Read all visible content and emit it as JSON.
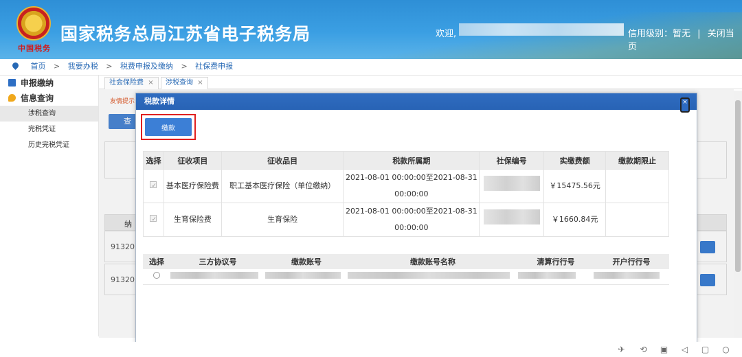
{
  "header": {
    "site_title": "国家税务总局江苏省电子税务局",
    "emblem_text": "中国税务",
    "welcome": "欢迎,",
    "credit": "信用级别：暂无",
    "divider": "|",
    "close_page": "关闭当页"
  },
  "breadcrumb": [
    "首页",
    "我要办税",
    "税费申报及缴纳",
    "社保费申报"
  ],
  "breadcrumb_sep": ">",
  "sidebar": {
    "groups": [
      {
        "label": "申报缴纳",
        "icon": "report-icon"
      },
      {
        "label": "信息查询",
        "icon": "chat-icon"
      }
    ],
    "items": [
      "涉税查询",
      "完税凭证",
      "历史完税凭证"
    ]
  },
  "tabs": [
    {
      "label": "社会保险费",
      "close": "×"
    },
    {
      "label": "涉税查询",
      "close": "×"
    }
  ],
  "background": {
    "notice": "友情提示",
    "query_btn": "查",
    "col_label": "纳",
    "row_ids": [
      "913207",
      "913207"
    ]
  },
  "modal": {
    "title": "税款详情",
    "close": "×",
    "pay_button": "缴款",
    "table1": {
      "headers": [
        "选择",
        "征收项目",
        "征收品目",
        "税款所属期",
        "社保编号",
        "实缴费额",
        "缴款期限止"
      ],
      "rows": [
        {
          "item": "基本医疗保险费",
          "subitem": "职工基本医疗保险（单位缴纳）",
          "period_1": "2021-08-01 00:00:00至2021-08-31",
          "period_2": "00:00:00",
          "amount": "￥15475.56元",
          "deadline": ""
        },
        {
          "item": "生育保险费",
          "subitem": "生育保险",
          "period_1": "2021-08-01 00:00:00至2021-08-31",
          "period_2": "00:00:00",
          "amount": "￥1660.84元",
          "deadline": ""
        }
      ]
    },
    "table2": {
      "headers": [
        "选择",
        "三方协议号",
        "缴款账号",
        "缴款账号名称",
        "清算行行号",
        "开户行行号"
      ]
    }
  },
  "colors": {
    "header_blue": "#3b9fe3",
    "modal_head": "#2863b5",
    "button_blue": "#3c7fd6",
    "highlight_red": "#e02020"
  }
}
